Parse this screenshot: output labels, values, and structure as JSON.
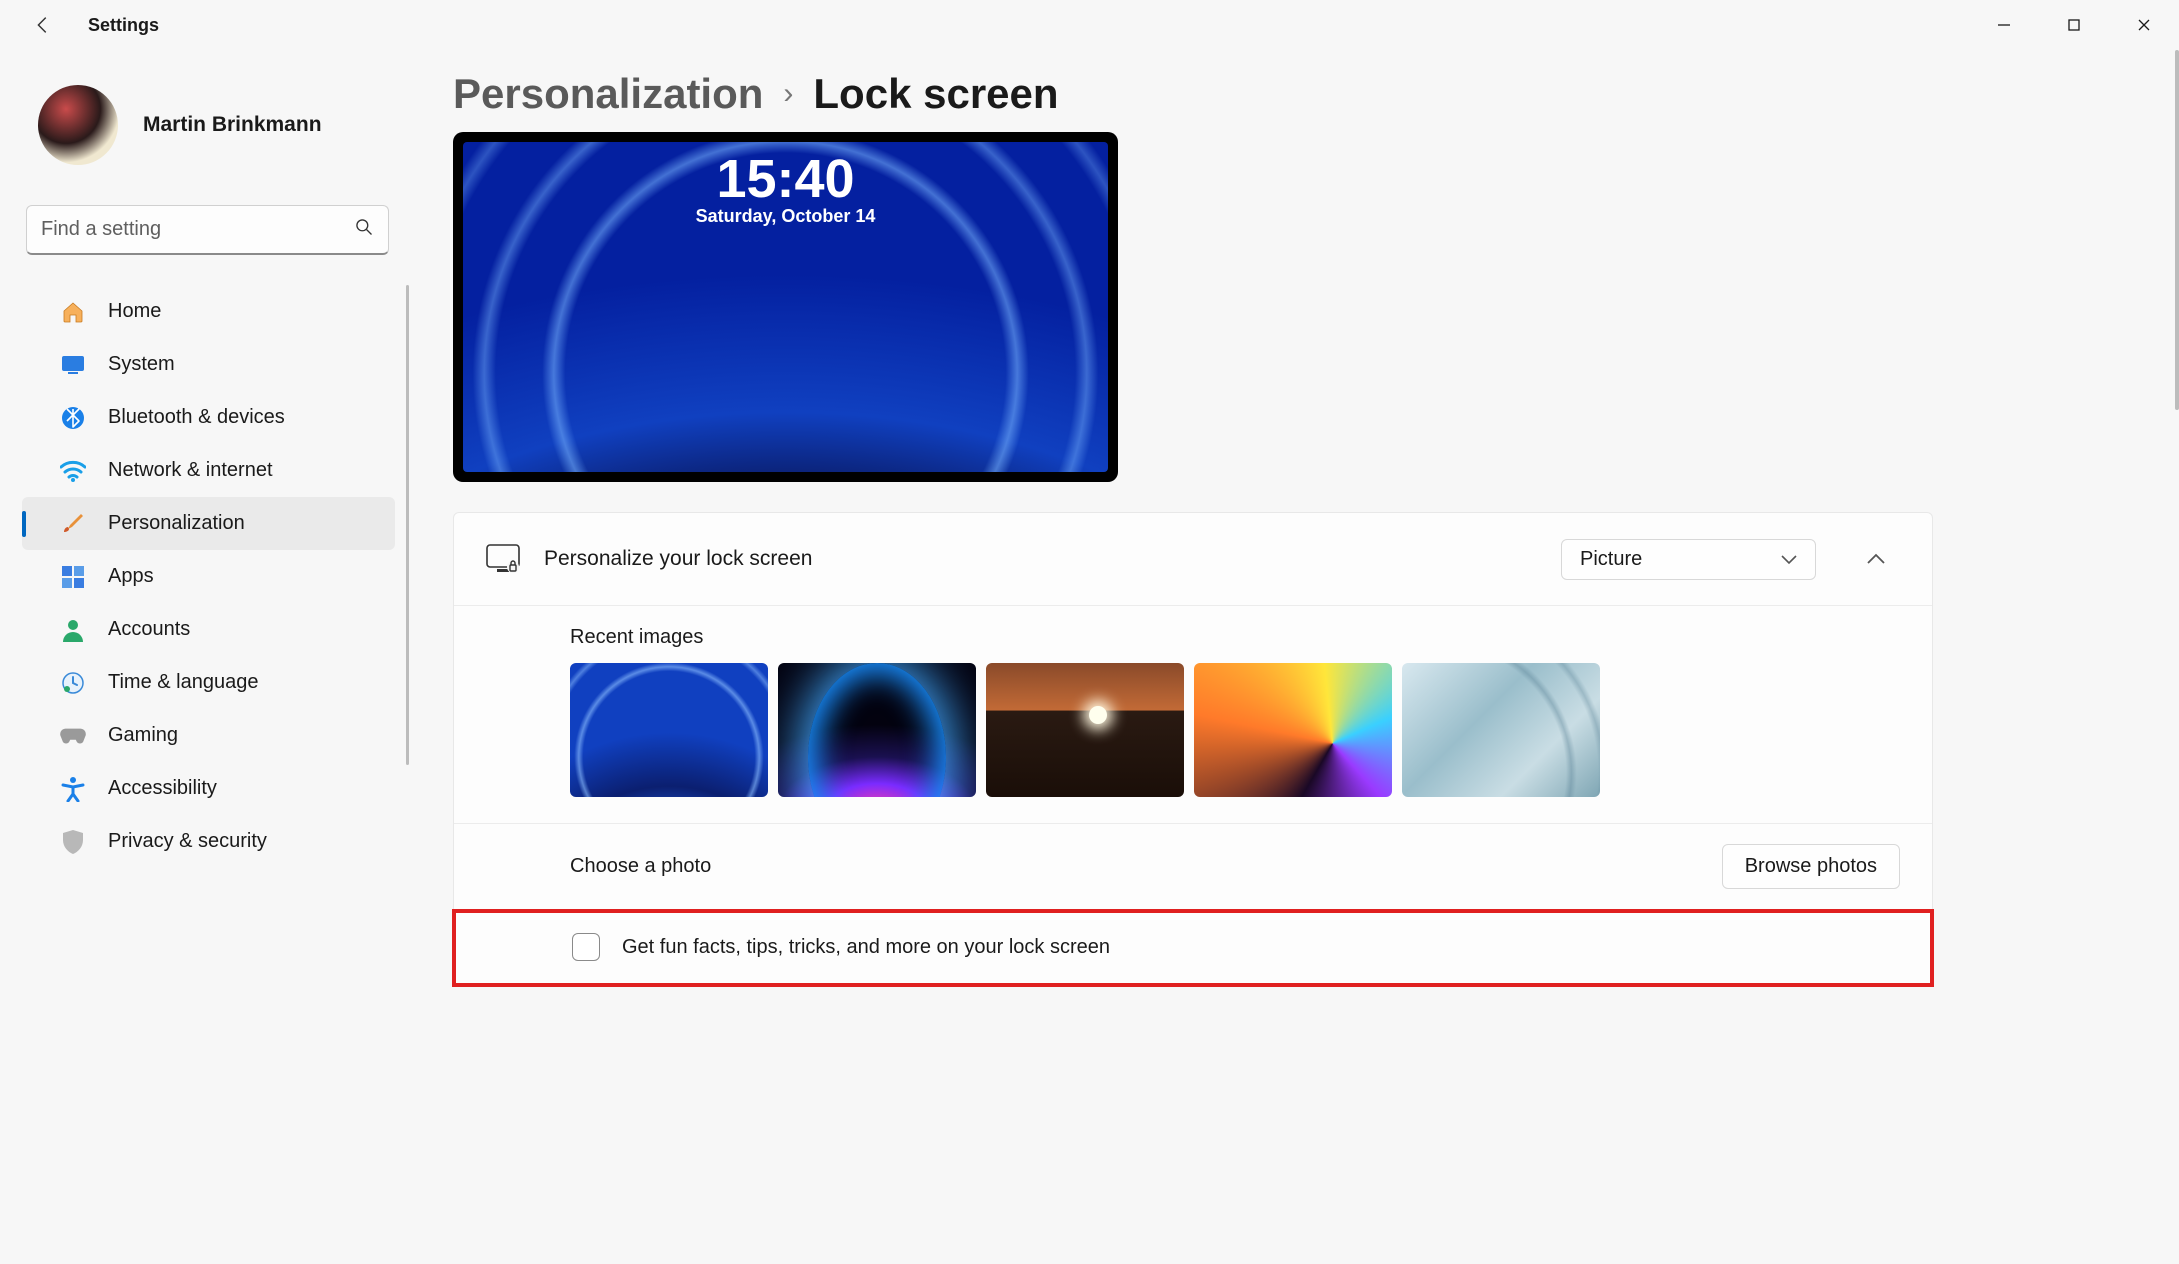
{
  "app": {
    "title": "Settings"
  },
  "window_controls": {
    "minimize": "Minimize",
    "maximize": "Maximize",
    "close": "Close"
  },
  "user": {
    "name": "Martin Brinkmann"
  },
  "search": {
    "placeholder": "Find a setting"
  },
  "sidebar": {
    "items": [
      {
        "id": "home",
        "label": "Home",
        "icon": "home-icon"
      },
      {
        "id": "system",
        "label": "System",
        "icon": "system-icon"
      },
      {
        "id": "bluetooth",
        "label": "Bluetooth & devices",
        "icon": "bluetooth-icon"
      },
      {
        "id": "network",
        "label": "Network & internet",
        "icon": "wifi-icon"
      },
      {
        "id": "personalization",
        "label": "Personalization",
        "icon": "brush-icon",
        "active": true
      },
      {
        "id": "apps",
        "label": "Apps",
        "icon": "apps-icon"
      },
      {
        "id": "accounts",
        "label": "Accounts",
        "icon": "account-icon"
      },
      {
        "id": "time",
        "label": "Time & language",
        "icon": "clock-icon"
      },
      {
        "id": "gaming",
        "label": "Gaming",
        "icon": "gamepad-icon"
      },
      {
        "id": "accessibility",
        "label": "Accessibility",
        "icon": "accessibility-icon"
      },
      {
        "id": "privacy",
        "label": "Privacy & security",
        "icon": "shield-icon"
      }
    ]
  },
  "breadcrumb": {
    "parent": "Personalization",
    "current": "Lock screen"
  },
  "lock_preview": {
    "time": "15:40",
    "date": "Saturday, October 14"
  },
  "personalize_card": {
    "label": "Personalize your lock screen",
    "dropdown_value": "Picture",
    "recent_label": "Recent images",
    "choose_label": "Choose a photo",
    "browse_label": "Browse photos",
    "funfacts_label": "Get fun facts, tips, tricks, and more on your lock screen",
    "funfacts_checked": false
  }
}
